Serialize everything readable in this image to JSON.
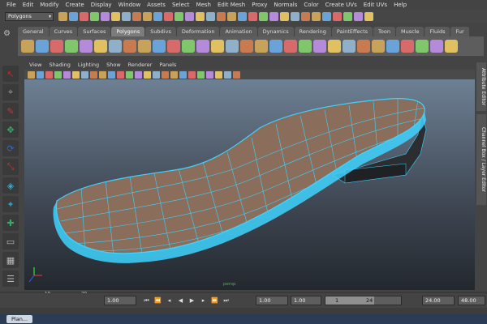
{
  "menu": [
    "File",
    "Edit",
    "Modify",
    "Create",
    "Display",
    "Window",
    "Assets",
    "Select",
    "Mesh",
    "Edit Mesh",
    "Proxy",
    "Normals",
    "Color",
    "Create UVs",
    "Edit UVs",
    "Help"
  ],
  "status_line": {
    "mode": "Polygons"
  },
  "shelf_tabs": [
    {
      "label": "General",
      "active": false
    },
    {
      "label": "Curves",
      "active": false
    },
    {
      "label": "Surfaces",
      "active": false
    },
    {
      "label": "Polygons",
      "active": true
    },
    {
      "label": "Subdivs",
      "active": false
    },
    {
      "label": "Deformation",
      "active": false
    },
    {
      "label": "Animation",
      "active": false
    },
    {
      "label": "Dynamics",
      "active": false
    },
    {
      "label": "Rendering",
      "active": false
    },
    {
      "label": "PaintEffects",
      "active": false
    },
    {
      "label": "Toon",
      "active": false
    },
    {
      "label": "Muscle",
      "active": false
    },
    {
      "label": "Fluids",
      "active": false
    },
    {
      "label": "Fur",
      "active": false
    }
  ],
  "panel_menu": [
    "View",
    "Shading",
    "Lighting",
    "Show",
    "Renderer",
    "Panels"
  ],
  "viewport": {
    "camera_label": "persp"
  },
  "side_tabs": [
    "Attribute Editor",
    "Channel Box / Layer Editor"
  ],
  "time_slider": {
    "ticks": [
      "10",
      "20"
    ]
  },
  "range": {
    "current_time": "1.00",
    "range_start": "1.00",
    "anim_start": "1.00",
    "handle_start": "1",
    "handle_end": "24",
    "range_end": "24.00",
    "anim_end": "48.00"
  },
  "taskbar": {
    "item": "Plan..."
  },
  "colors": {
    "mesh_face": "#8a6d5b",
    "wire": "#3fd4ff",
    "viewport_top": "#6e8094",
    "viewport_bottom": "#23282e"
  }
}
